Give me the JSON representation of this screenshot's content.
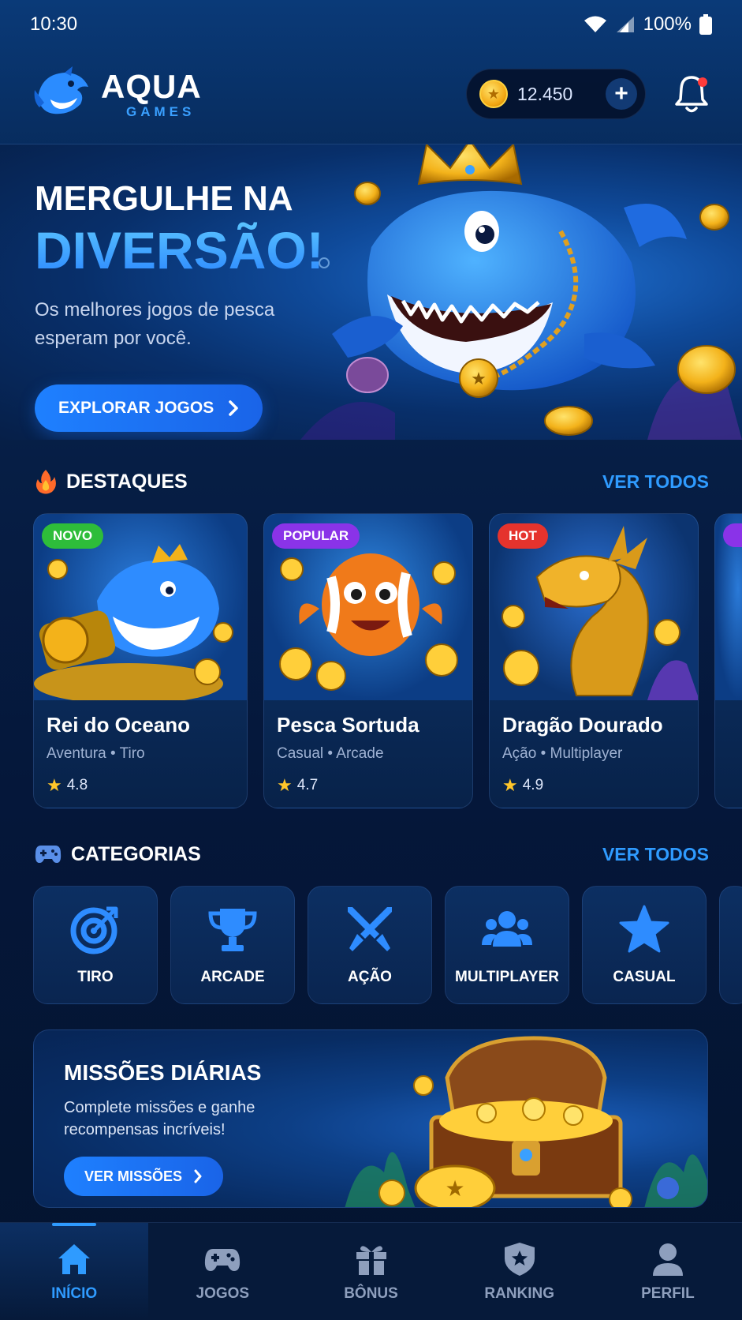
{
  "status_bar": {
    "time": "10:30",
    "battery": "100%"
  },
  "header": {
    "logo_title": "AQUA",
    "logo_subtitle": "GAMES",
    "coin_balance": "12.450",
    "add_label": "+"
  },
  "hero": {
    "line1": "MERGULHE NA",
    "line2": "DIVERSÃO!",
    "description": "Os melhores jogos de pesca esperam por você.",
    "button_label": "EXPLORAR JOGOS"
  },
  "featured": {
    "title": "DESTAQUES",
    "see_all": "VER TODOS",
    "games": [
      {
        "badge": "NOVO",
        "badge_color": "#2ebd3a",
        "name": "Rei do Oceano",
        "genre": "Aventura • Tiro",
        "rating": "4.8"
      },
      {
        "badge": "POPULAR",
        "badge_color": "#8a33e8",
        "name": "Pesca Sortuda",
        "genre": "Casual • Arcade",
        "rating": "4.7"
      },
      {
        "badge": "HOT",
        "badge_color": "#e5332d",
        "name": "Dragão Dourado",
        "genre": "Ação • Multiplayer",
        "rating": "4.9"
      }
    ]
  },
  "categories": {
    "title": "CATEGORIAS",
    "see_all": "VER TODOS",
    "items": [
      {
        "label": "TIRO",
        "icon": "target-icon"
      },
      {
        "label": "ARCADE",
        "icon": "trophy-icon"
      },
      {
        "label": "AÇÃO",
        "icon": "crossed-swords-icon"
      },
      {
        "label": "MULTIPLAYER",
        "icon": "users-icon"
      },
      {
        "label": "CASUAL",
        "icon": "star-icon"
      }
    ]
  },
  "missions": {
    "title": "MISSÕES DIÁRIAS",
    "description": "Complete missões e ganhe recompensas incríveis!",
    "button_label": "VER MISSÕES"
  },
  "bottom_nav": {
    "items": [
      {
        "label": "INÍCIO",
        "icon": "home-icon",
        "active": true
      },
      {
        "label": "JOGOS",
        "icon": "gamepad-icon",
        "active": false
      },
      {
        "label": "BÔNUS",
        "icon": "gift-icon",
        "active": false
      },
      {
        "label": "RANKING",
        "icon": "shield-star-icon",
        "active": false
      },
      {
        "label": "PERFIL",
        "icon": "user-icon",
        "active": false
      }
    ]
  },
  "colors": {
    "accent": "#2f9bff",
    "background": "#05173a",
    "gold": "#ffc62a"
  }
}
